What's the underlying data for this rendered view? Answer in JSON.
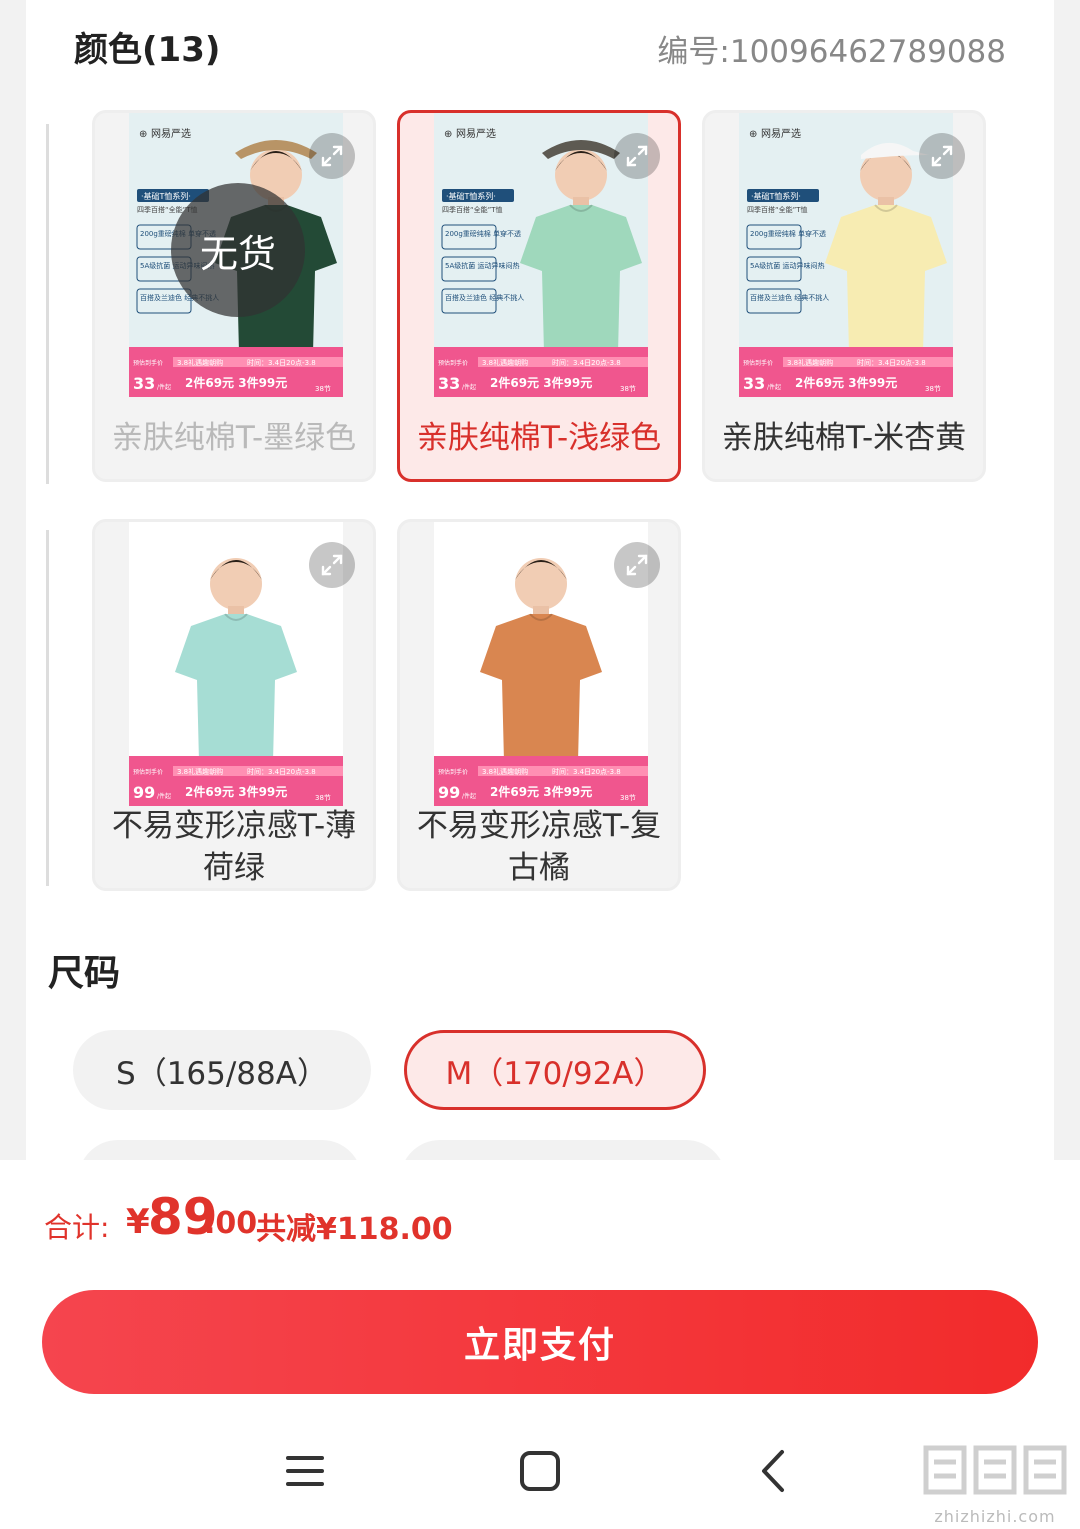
{
  "colors_section": {
    "title": "颜色(13)",
    "item_no": "编号:10096462789088"
  },
  "color_options": [
    {
      "label": "亲肤纯棉T-墨绿色",
      "state": "sold_out",
      "badge": "无货",
      "shirt_color": "#234a36"
    },
    {
      "label": "亲肤纯棉T-浅绿色",
      "state": "selected",
      "shirt_color": "#9fd8bc"
    },
    {
      "label": "亲肤纯棉T-米杏黄",
      "state": "normal",
      "shirt_color": "#f7ecb2"
    },
    {
      "label": "不易变形凉感T-薄荷绿",
      "state": "normal",
      "shirt_color": "#a6ddd4"
    },
    {
      "label": "不易变形凉感T-复古橘",
      "state": "normal",
      "shirt_color": "#d98650"
    }
  ],
  "promo": {
    "brand": "网易严选",
    "series": "·基础T恤系列·",
    "sub": "四季百搭“全能”T恤",
    "feat1": "200g重磅纯棉 单穿不透",
    "feat2": "5A级抗菌 运动异味闷热",
    "feat3": "百搭及兰迪色 经典不挑人",
    "est_label": "预估到手价",
    "event": "3.8礼遇趣朝购",
    "time": "时间：3.4日20点-3.8",
    "deal": "2件69元 3件99元",
    "fest": "38节",
    "price_a": "33",
    "price_b": "99",
    "unit": "/件起"
  },
  "size_section": {
    "title": "尺码",
    "options": [
      {
        "label": "S（165/88A）",
        "selected": false
      },
      {
        "label": "M（170/92A）",
        "selected": true
      }
    ]
  },
  "total": {
    "label": "合计:",
    "currency": "¥",
    "integer": "89",
    "decimal": ".00",
    "saving": "共减¥118.00"
  },
  "pay_button": "立即支付",
  "watermark": "zhizhizhi.com",
  "accent_color": "#d8302b"
}
